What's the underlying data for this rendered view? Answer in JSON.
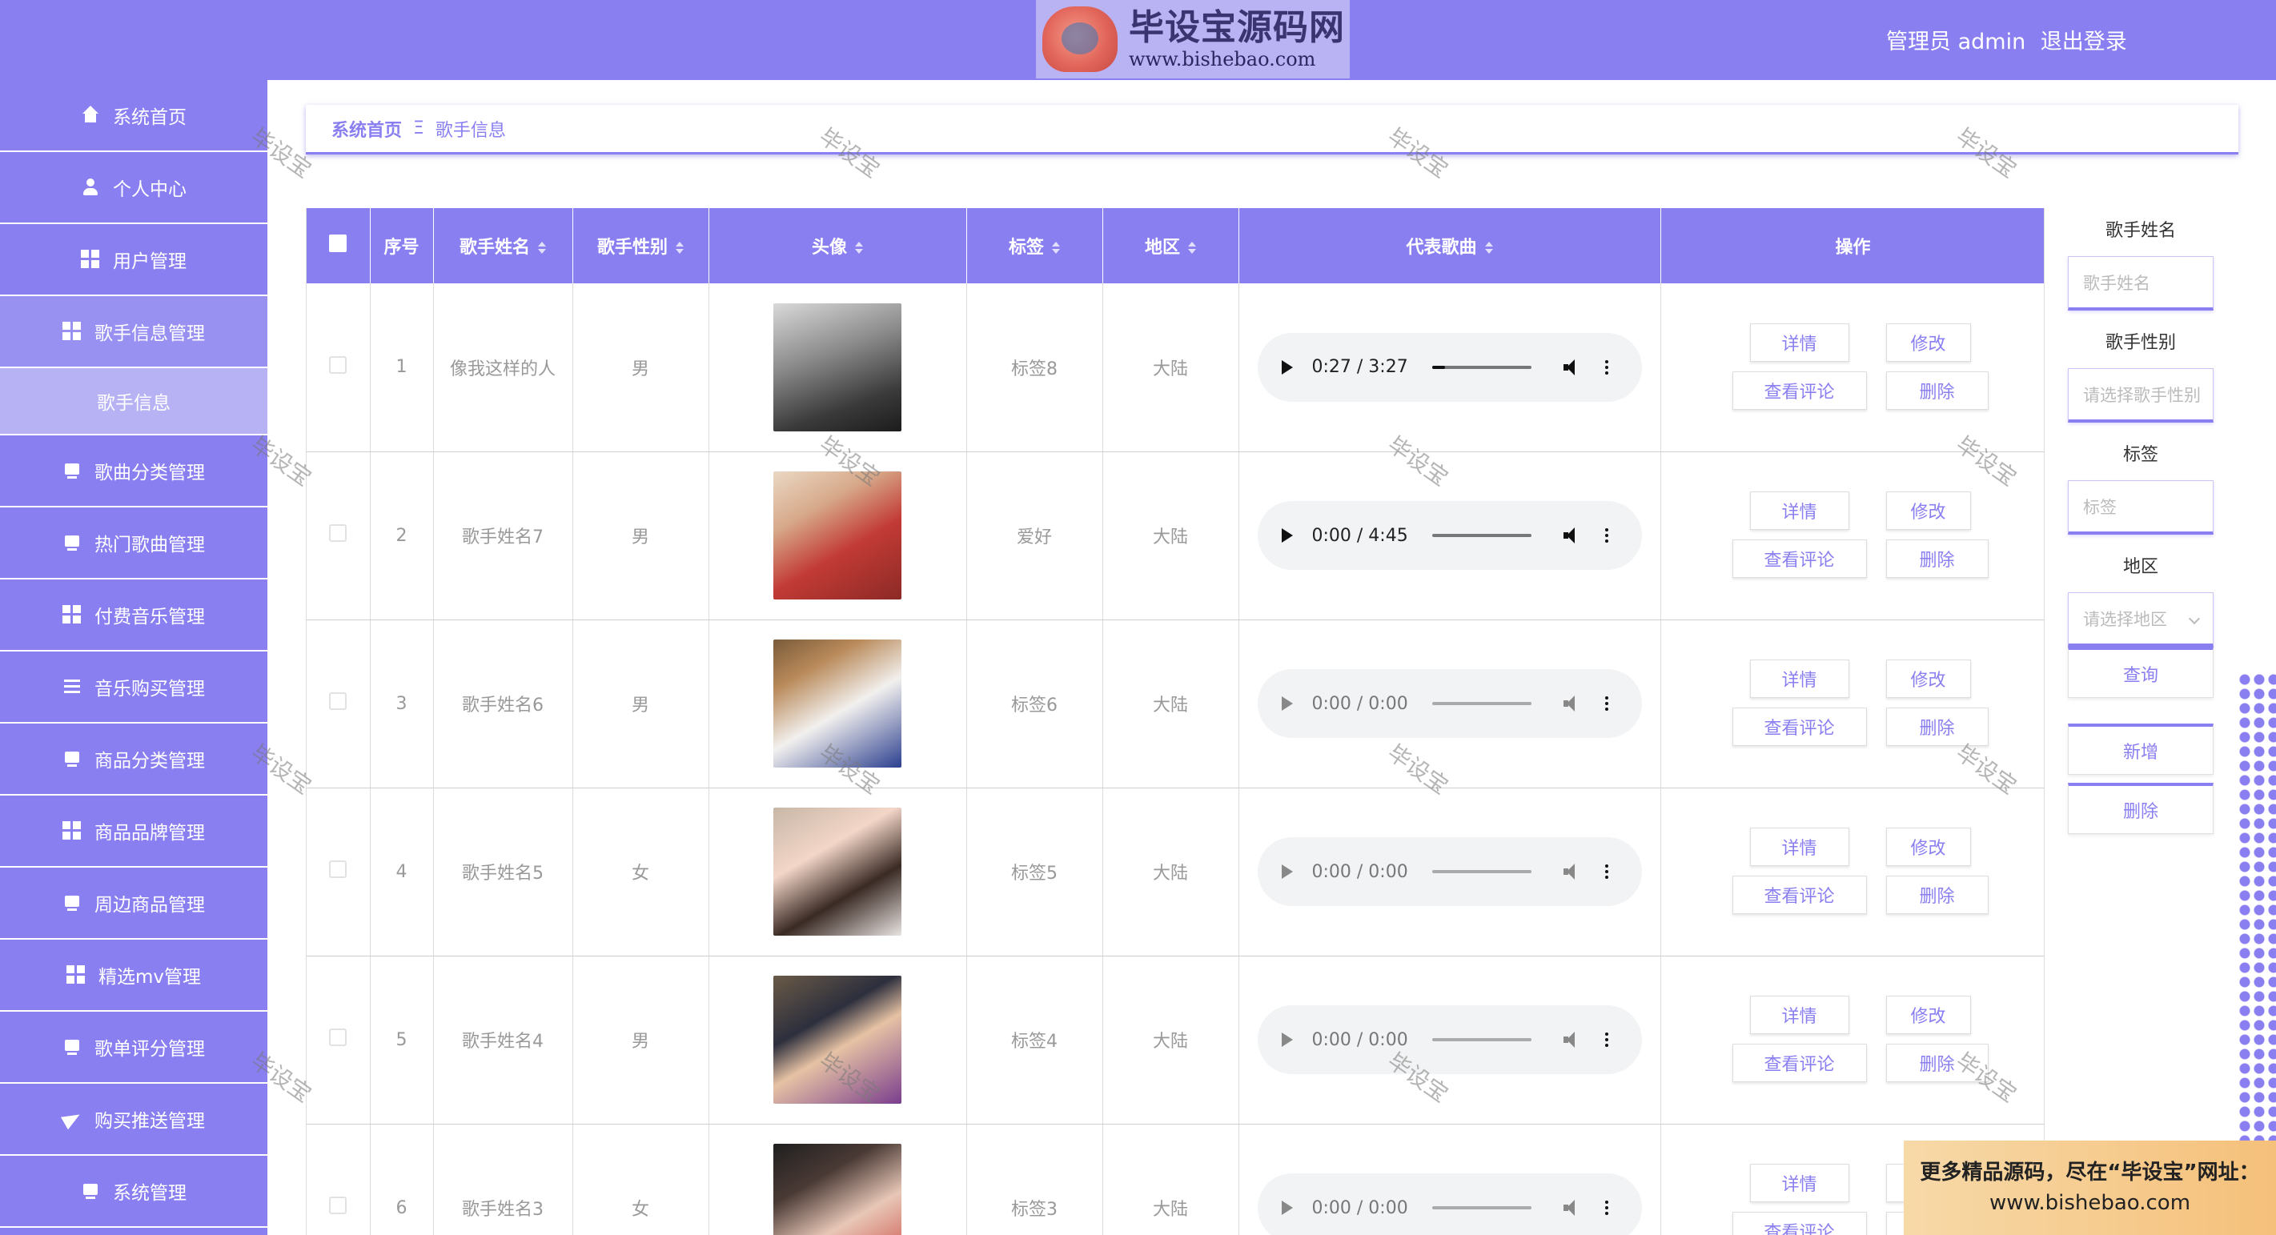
{
  "header": {
    "logo_title": "毕设宝源码网",
    "logo_url": "www.bishebao.com",
    "user_label": "管理员 admin",
    "logout": "退出登录"
  },
  "sidebar": {
    "items": [
      {
        "label": "系统首页",
        "icon": "home-icon"
      },
      {
        "label": "个人中心",
        "icon": "user-icon"
      },
      {
        "label": "用户管理",
        "icon": "grid-icon"
      },
      {
        "label": "歌手信息管理",
        "icon": "grid-icon"
      },
      {
        "label": "歌手信息",
        "icon": ""
      },
      {
        "label": "歌曲分类管理",
        "icon": "box-icon"
      },
      {
        "label": "热门歌曲管理",
        "icon": "box-icon"
      },
      {
        "label": "付费音乐管理",
        "icon": "grid-icon"
      },
      {
        "label": "音乐购买管理",
        "icon": "list-icon"
      },
      {
        "label": "商品分类管理",
        "icon": "box-icon"
      },
      {
        "label": "商品品牌管理",
        "icon": "grid-icon"
      },
      {
        "label": "周边商品管理",
        "icon": "box-icon"
      },
      {
        "label": "精选mv管理",
        "icon": "grid-icon"
      },
      {
        "label": "歌单评分管理",
        "icon": "box-icon"
      },
      {
        "label": "购买推送管理",
        "icon": "send-icon"
      },
      {
        "label": "系统管理",
        "icon": "box-icon"
      }
    ]
  },
  "breadcrumb": {
    "home": "系统首页",
    "separator": "Ξ",
    "current": "歌手信息"
  },
  "table": {
    "headers": {
      "index": "序号",
      "name": "歌手姓名",
      "gender": "歌手性别",
      "avatar": "头像",
      "tag": "标签",
      "region": "地区",
      "song": "代表歌曲",
      "ops": "操作"
    },
    "rows": [
      {
        "index": "1",
        "name": "像我这样的人",
        "gender": "男",
        "tag": "标签8",
        "region": "大陆",
        "time": "0:27 / 3:27",
        "progress": 0.13,
        "playable": true
      },
      {
        "index": "2",
        "name": "歌手姓名7",
        "gender": "男",
        "tag": "爱好",
        "region": "大陆",
        "time": "0:00 / 4:45",
        "progress": 0.0,
        "playable": true
      },
      {
        "index": "3",
        "name": "歌手姓名6",
        "gender": "男",
        "tag": "标签6",
        "region": "大陆",
        "time": "0:00 / 0:00",
        "progress": 0.0,
        "playable": false
      },
      {
        "index": "4",
        "name": "歌手姓名5",
        "gender": "女",
        "tag": "标签5",
        "region": "大陆",
        "time": "0:00 / 0:00",
        "progress": 0.0,
        "playable": false
      },
      {
        "index": "5",
        "name": "歌手姓名4",
        "gender": "男",
        "tag": "标签4",
        "region": "大陆",
        "time": "0:00 / 0:00",
        "progress": 0.0,
        "playable": false
      },
      {
        "index": "6",
        "name": "歌手姓名3",
        "gender": "女",
        "tag": "标签3",
        "region": "大陆",
        "time": "0:00 / 0:00",
        "progress": 0.0,
        "playable": false
      }
    ],
    "actions": {
      "detail": "详情",
      "edit": "修改",
      "comments": "查看评论",
      "delete": "删除"
    }
  },
  "search": {
    "name_label": "歌手姓名",
    "name_placeholder": "歌手姓名",
    "gender_label": "歌手性别",
    "gender_placeholder": "请选择歌手性别",
    "tag_label": "标签",
    "tag_placeholder": "标签",
    "region_label": "地区",
    "region_placeholder": "请选择地区",
    "query": "查询",
    "add": "新增",
    "delete": "删除"
  },
  "watermark": "毕设宝",
  "promo": {
    "line1": "更多精品源码，尽在“毕设宝”网址：",
    "line2": "www.bishebao.com"
  },
  "colors": {
    "accent": "#8a7ff0",
    "sub_item": "#b7b2f3"
  }
}
